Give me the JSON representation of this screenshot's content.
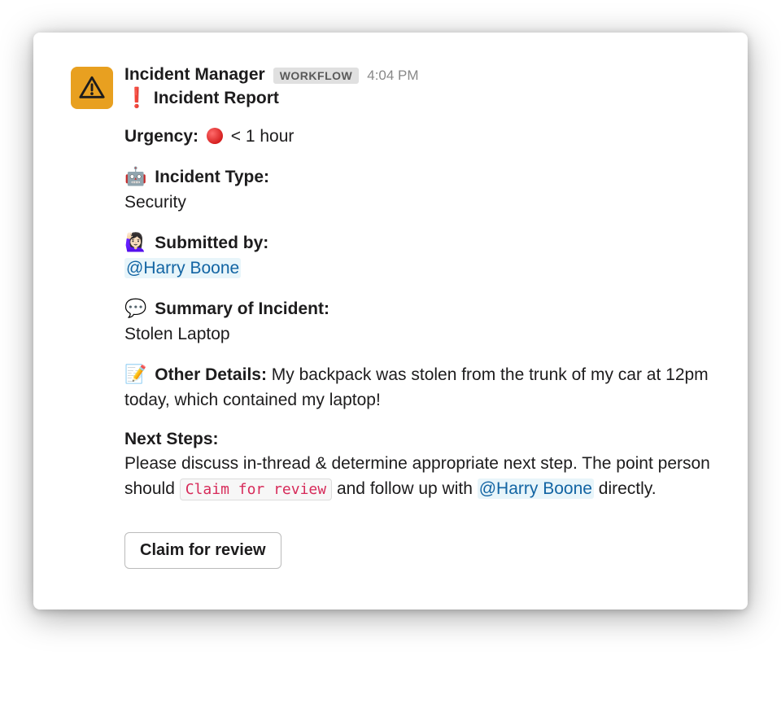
{
  "message": {
    "author": "Incident Manager",
    "badge": "WORKFLOW",
    "timestamp": "4:04 PM",
    "title": "Incident Report",
    "urgency": {
      "label": "Urgency:",
      "value": "< 1 hour"
    },
    "incident_type": {
      "emoji": "🤖",
      "label": "Incident Type:",
      "value": "Security"
    },
    "submitted_by": {
      "emoji": "🙋🏻‍♀️",
      "label": "Submitted by:",
      "mention": "@Harry Boone"
    },
    "summary": {
      "emoji": "💬",
      "label": "Summary of Incident:",
      "value": "Stolen Laptop"
    },
    "other_details": {
      "emoji": "📝",
      "label": "Other Details:",
      "value": "My backpack was stolen from the trunk of my car at 12pm today, which contained my laptop!"
    },
    "next_steps": {
      "label": "Next Steps:",
      "text_before": "Please discuss in-thread & determine appropriate next step. The point person should ",
      "code": "Claim for review",
      "text_mid": " and follow up with ",
      "mention": "@Harry Boone",
      "text_after": " directly."
    },
    "action_button": "Claim for review"
  }
}
